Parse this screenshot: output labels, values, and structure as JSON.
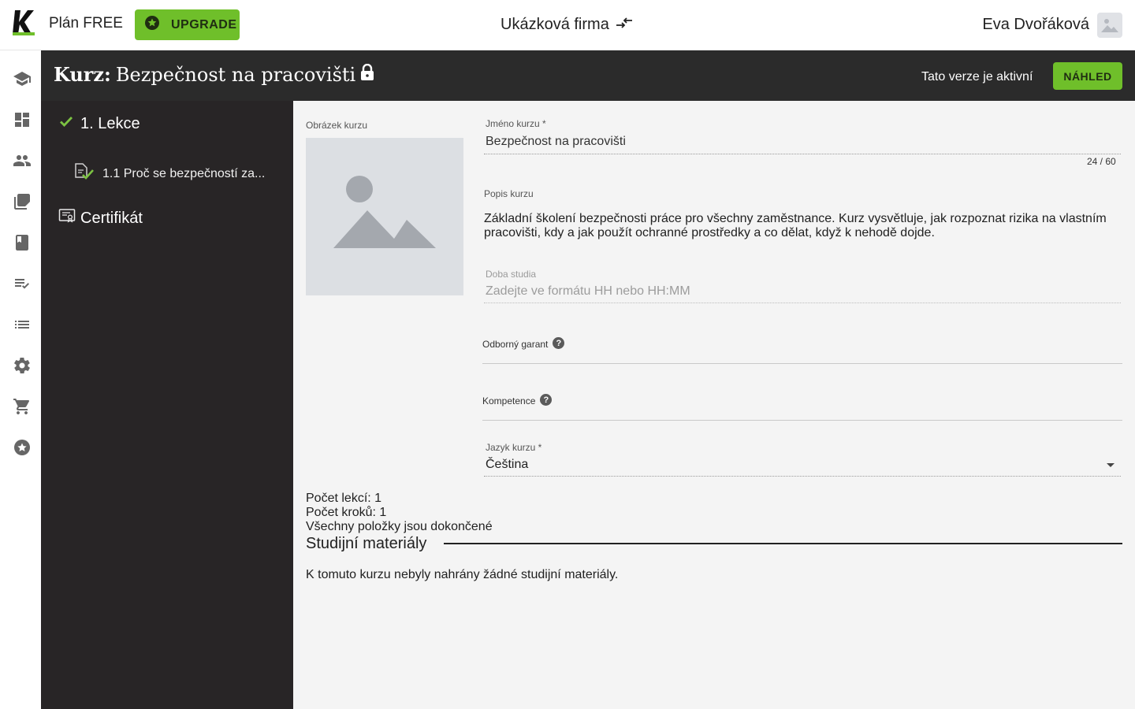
{
  "topbar": {
    "plan_label": "Plán FREE",
    "upgrade_label": "UPGRADE",
    "company_name": "Ukázková firma",
    "user_name": "Eva Dvořáková"
  },
  "header": {
    "title_prefix": "Kurz:",
    "title": "Bezpečnost na pracovišti",
    "status": "Tato verze je aktivní",
    "preview_label": "NÁHLED"
  },
  "rail": {
    "items": [
      "school-icon",
      "dashboard-icon",
      "people-icon",
      "library-icon",
      "book-icon",
      "checklist-icon",
      "list-icon",
      "settings-icon",
      "cart-icon",
      "star-icon"
    ]
  },
  "tree": {
    "lesson": "1. Lekce",
    "step": "1.1 Proč se bezpečností za...",
    "certificate": "Certifikát"
  },
  "form": {
    "image_label": "Obrázek kurzu",
    "name_label": "Jméno kurzu *",
    "name_value": "Bezpečnost na pracovišti",
    "name_counter": "24 / 60",
    "description_label": "Popis kurzu",
    "description_value": "Základní školení bezpečnosti práce pro všechny zaměstnance. Kurz vysvětluje, jak rozpoznat rizika na vlastním pracovišti, kdy a jak použít ochranné prostředky a co dělat, když k nehodě dojde.",
    "duration_label": "Doba studia",
    "duration_placeholder": "Zadejte ve formátu HH nebo HH:MM",
    "garant_label": "Odborný garant",
    "competence_label": "Kompetence",
    "language_label": "Jazyk kurzu *",
    "language_value": "Čeština"
  },
  "stats": {
    "lessons": "Počet lekcí: 1",
    "steps": "Počet kroků: 1",
    "completion": "Všechny položky jsou dokončené"
  },
  "materials": {
    "title": "Studijní materiály",
    "empty_text": "K tomuto kurzu nebyly nahrány žádné studijní materiály."
  },
  "colors": {
    "accent": "#6fbf2a",
    "header_bg": "#2b2b2b",
    "tree_bg": "#282526"
  }
}
